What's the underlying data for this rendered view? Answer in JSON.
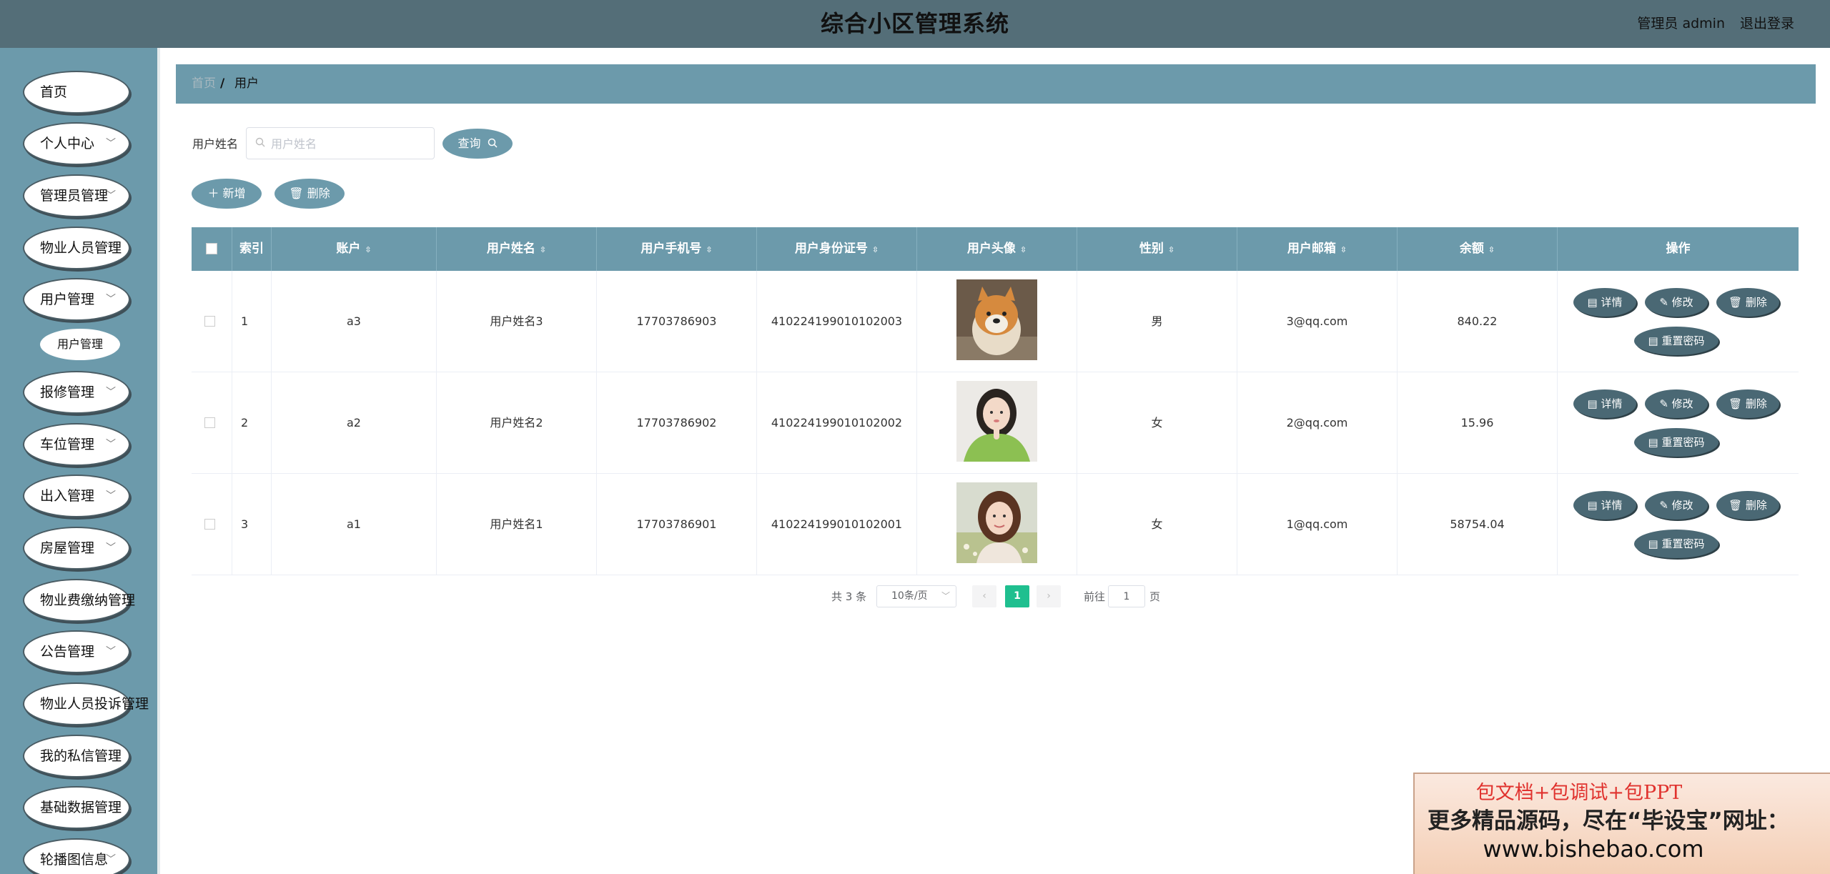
{
  "header": {
    "title": "综合小区管理系统",
    "admin_label": "管理员 admin",
    "logout_label": "退出登录"
  },
  "sidebar": {
    "items": [
      {
        "label": "首页",
        "has_children": false
      },
      {
        "label": "个人中心",
        "has_children": true
      },
      {
        "label": "管理员管理",
        "has_children": true
      },
      {
        "label": "物业人员管理",
        "has_children": true
      },
      {
        "label": "用户管理",
        "has_children": true
      },
      {
        "label": "报修管理",
        "has_children": true
      },
      {
        "label": "车位管理",
        "has_children": true
      },
      {
        "label": "出入管理",
        "has_children": true
      },
      {
        "label": "房屋管理",
        "has_children": true
      },
      {
        "label": "物业费缴纳管理",
        "has_children": true
      },
      {
        "label": "公告管理",
        "has_children": true
      },
      {
        "label": "物业人员投诉管理",
        "has_children": true
      },
      {
        "label": "我的私信管理",
        "has_children": true
      },
      {
        "label": "基础数据管理",
        "has_children": true
      },
      {
        "label": "轮播图信息",
        "has_children": true
      }
    ],
    "sub_item": "用户管理"
  },
  "breadcrumb": {
    "home": "首页",
    "separator": "/",
    "current": "用户"
  },
  "search": {
    "label": "用户姓名",
    "placeholder": "用户姓名",
    "value": "",
    "query_label": "查询"
  },
  "actions": {
    "add_label": "新增",
    "delete_label": "删除"
  },
  "table": {
    "columns": [
      "索引",
      "账户",
      "用户姓名",
      "用户手机号",
      "用户身份证号",
      "用户头像",
      "性别",
      "用户邮箱",
      "余额",
      "操作"
    ],
    "rows": [
      {
        "index": "1",
        "account": "a3",
        "name": "用户姓名3",
        "phone": "17703786903",
        "id_card": "410224199010102003",
        "avatar": "shiba-dog-photo",
        "gender": "男",
        "email": "3@qq.com",
        "balance": "840.22"
      },
      {
        "index": "2",
        "account": "a2",
        "name": "用户姓名2",
        "phone": "17703786902",
        "id_card": "410224199010102002",
        "avatar": "woman-green-sweater-photo",
        "gender": "女",
        "email": "2@qq.com",
        "balance": "15.96"
      },
      {
        "index": "3",
        "account": "a1",
        "name": "用户姓名1",
        "phone": "17703786901",
        "id_card": "410224199010102001",
        "avatar": "woman-flowers-photo",
        "gender": "女",
        "email": "1@qq.com",
        "balance": "58754.04"
      }
    ],
    "row_actions": {
      "detail": "详情",
      "edit": "修改",
      "delete": "删除",
      "reset": "重置密码"
    }
  },
  "pagination": {
    "total": "共 3 条",
    "page_size": "10条/页",
    "current_page": "1",
    "goto_label": "前往",
    "goto_value": "1",
    "page_suffix": "页"
  },
  "banner": {
    "line1": "包文档+包调试+包PPT",
    "line2": "更多精品源码，尽在“毕设宝”网址：",
    "line3": "www.bishebao.com"
  },
  "colors": {
    "header_bg": "#546e78",
    "sidebar_bg": "#6c9aab",
    "table_header_bg": "#6c9aab",
    "op_button_bg": "#4a6874",
    "pagination_active": "#1fbf8f"
  }
}
